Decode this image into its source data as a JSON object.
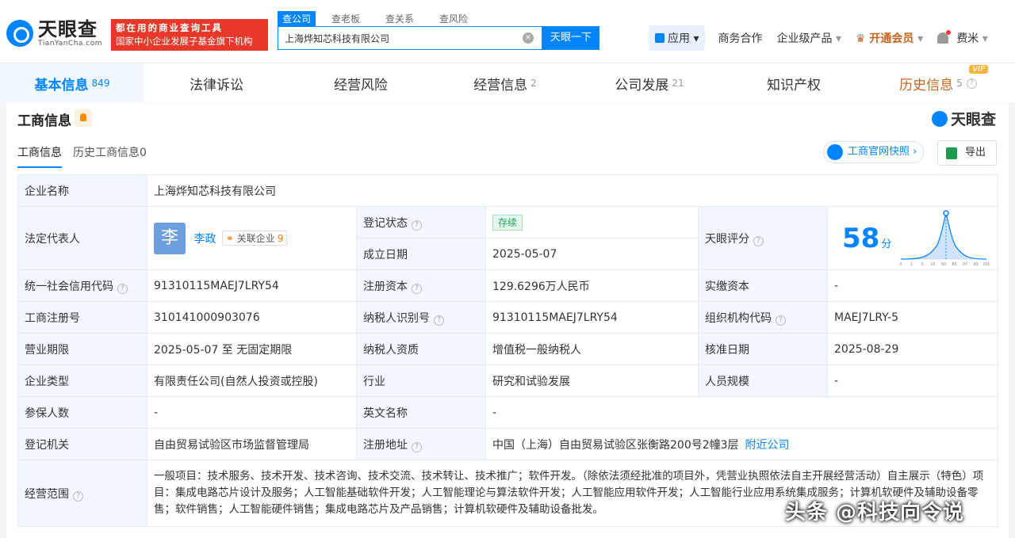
{
  "header": {
    "logo_cn": "天眼查",
    "logo_en": "TianYanCha.com",
    "slogan_line1": "都在用的商业查询工具",
    "slogan_line2": "国家中小企业发展子基金旗下机构",
    "search_tabs": [
      "查公司",
      "查老板",
      "查关系",
      "查风险"
    ],
    "search_value": "上海烨知芯科技有限公司",
    "search_button": "天眼一下",
    "nav": {
      "app": "应用",
      "business": "商务合作",
      "enterprise": "企业级产品",
      "vip": "开通会员",
      "user": "费米"
    }
  },
  "tabs": [
    {
      "label": "基本信息",
      "count": "849"
    },
    {
      "label": "法律诉讼",
      "count": ""
    },
    {
      "label": "经营风险",
      "count": ""
    },
    {
      "label": "经营信息",
      "count": "2"
    },
    {
      "label": "公司发展",
      "count": "21"
    },
    {
      "label": "知识产权",
      "count": ""
    },
    {
      "label": "历史信息",
      "count": "5",
      "badge": "VIP"
    }
  ],
  "section": {
    "title": "工商信息",
    "brand": "天眼查",
    "subtabs": [
      "工商信息",
      "历史工商信息0"
    ],
    "snapshot_btn": "工商官网快照",
    "export_btn": "导出"
  },
  "info": {
    "company_name_label": "企业名称",
    "company_name": "上海烨知芯科技有限公司",
    "legal_rep_label": "法定代表人",
    "legal_rep_avatar": "李",
    "legal_rep_name": "李政",
    "related_label": "关联企业",
    "related_count": "9",
    "reg_status_label": "登记状态",
    "reg_status": "存续",
    "found_date_label": "成立日期",
    "found_date": "2025-05-07",
    "score_label": "天眼评分",
    "score": "58",
    "score_unit": "分",
    "credit_code_label": "统一社会信用代码",
    "credit_code": "91310115MAEJ7LRY54",
    "reg_capital_label": "注册资本",
    "reg_capital": "129.6296万人民币",
    "paid_capital_label": "实缴资本",
    "paid_capital": "-",
    "reg_no_label": "工商注册号",
    "reg_no": "310141000903076",
    "tax_id_label": "纳税人识别号",
    "tax_id": "91310115MAEJ7LRY54",
    "org_code_label": "组织机构代码",
    "org_code": "MAEJ7LRY-5",
    "term_label": "营业期限",
    "term": "2025-05-07 至 无固定期限",
    "tax_quali_label": "纳税人资质",
    "tax_quali": "增值税一般纳税人",
    "approve_date_label": "核准日期",
    "approve_date": "2025-08-29",
    "type_label": "企业类型",
    "type": "有限责任公司(自然人投资或控股)",
    "industry_label": "行业",
    "industry": "研究和试验发展",
    "staff_label": "人员规模",
    "staff": "-",
    "insured_label": "参保人数",
    "insured": "-",
    "en_name_label": "英文名称",
    "en_name": "-",
    "authority_label": "登记机关",
    "authority": "自由贸易试验区市场监督管理局",
    "address_label": "注册地址",
    "address": "中国（上海）自由贸易试验区张衡路200号2幢3层",
    "nearby": "附近公司",
    "scope_label": "经营范围",
    "scope": "一般项目：技术服务、技术开发、技术咨询、技术交流、技术转让、技术推广；软件开发。（除依法须经批准的项目外，凭营业执照依法自主开展经营活动）自主展示（特色）项目：集成电路芯片设计及服务；人工智能基础软件开发；人工智能理论与算法软件开发；人工智能应用软件开发；人工智能行业应用系统集成服务；计算机软硬件及辅助设备零售；软件销售；人工智能硬件销售；集成电路芯片及产品销售；计算机软硬件及辅助设备批发。"
  },
  "score_axis": [
    "0",
    "1",
    "3",
    "15",
    "50",
    "85",
    "97",
    "99",
    "100"
  ],
  "watermark": "头条 @科技向令说"
}
